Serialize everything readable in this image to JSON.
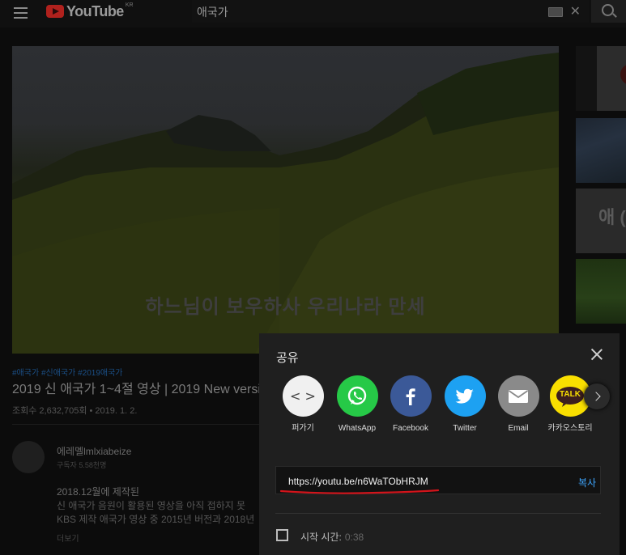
{
  "header": {
    "logo_text": "YouTube",
    "region": "KR",
    "search_value": "애국가"
  },
  "video": {
    "subtitle": "하느님이 보우하사 우리나라 만세",
    "tags": "#애국가 #신애국가 #2019애국가",
    "title": "2019 신 애국가 1~4절 영상 | 2019 New versi",
    "views": "조회수 2,632,705회 • 2019. 1. 2."
  },
  "sidebar_thumbs": {
    "thumb3_text": "애 ("
  },
  "channel": {
    "name": "에레멜lmlxiabeize",
    "subscribers": "구독자 5.58천명",
    "desc_line1": "2018.12월에 제작된",
    "desc_line2": "신 애국가 음원이 활용된 영상을 아직 접하지 못",
    "desc_line3": "KBS 제작 애국가 영상 중 2015년 버전과 2018년",
    "more": "더보기"
  },
  "share": {
    "title": "공유",
    "targets": [
      {
        "label": "퍼가기",
        "icon": "embed-icon"
      },
      {
        "label": "WhatsApp",
        "icon": "whatsapp-icon"
      },
      {
        "label": "Facebook",
        "icon": "facebook-icon"
      },
      {
        "label": "Twitter",
        "icon": "twitter-icon"
      },
      {
        "label": "Email",
        "icon": "email-icon"
      },
      {
        "label": "카카오스토리",
        "icon": "kakaotalk-icon"
      }
    ],
    "kakao_badge": "TALK",
    "embed_glyph": "< >",
    "url": "https://youtu.be/n6WaTObHRJM",
    "copy_label": "복사",
    "start_time_label": "시작 시간:",
    "start_time_value": "0:38"
  },
  "colors": {
    "accent_blue": "#3ea6ff",
    "annotation_red": "#d3141b"
  }
}
